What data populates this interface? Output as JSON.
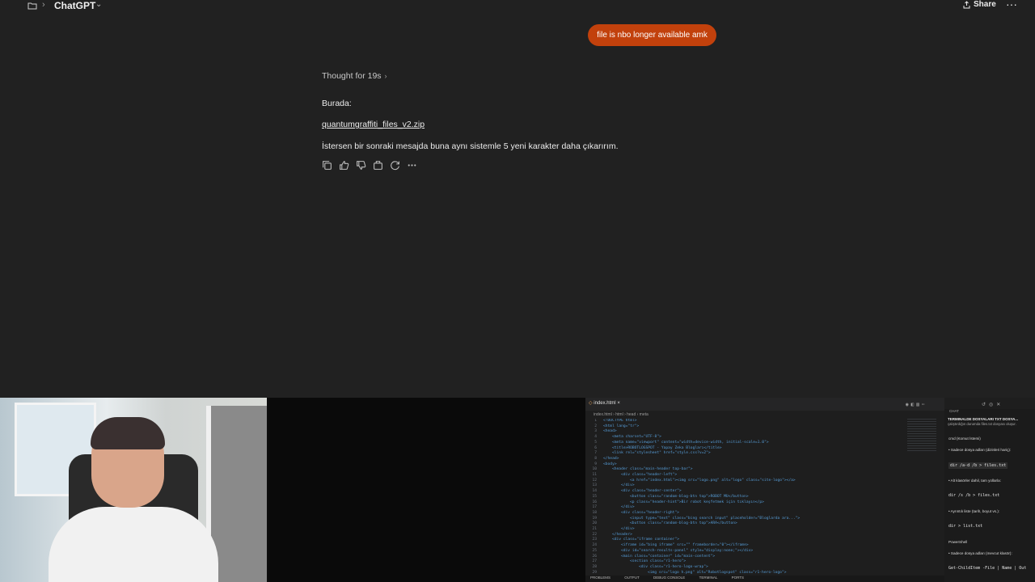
{
  "header": {
    "title": "ChatGPT",
    "breadcrumb_sep": "›",
    "title_chevron": "⌄",
    "share_label": "Share",
    "more_label": "···"
  },
  "conversation": {
    "user_message": "file is nbo longer available amk",
    "thought_label": "Thought for 19s",
    "thought_chevron": "›",
    "para1": "Burada:",
    "link": "quantumgraffiti_files_v2.zip",
    "para2": "İstersen bir sonraki mesajda buna aynı sistemle 5 yeni karakter daha çıkarırım.",
    "actions": [
      "copy-icon",
      "thumbs-up-icon",
      "thumbs-down-icon",
      "share-icon",
      "regenerate-icon",
      "more-icon"
    ]
  },
  "vscode": {
    "tab_label": "index.html",
    "tab_close": "×",
    "breadcrumb": "index.html › html › head › meta",
    "status_left": "PROBLEMS",
    "status_items": [
      "OUTPUT",
      "DEBUG CONSOLE",
      "TERMINAL",
      "PORTS"
    ],
    "code_lines": [
      {
        "n": "1",
        "indent": 0,
        "text": "<!DOCTYPE html>"
      },
      {
        "n": "2",
        "indent": 0,
        "text": "<html lang=\"tr\">"
      },
      {
        "n": "3",
        "indent": 0,
        "text": "<head>"
      },
      {
        "n": "4",
        "indent": 1,
        "text": "<meta charset=\"UTF-8\">"
      },
      {
        "n": "5",
        "indent": 1,
        "text": "<meta name=\"viewport\" content=\"width=device-width, initial-scale=1.0\">"
      },
      {
        "n": "6",
        "indent": 1,
        "text": "<title>ROBOTLOGSPOT - Yapay Zeka Blogları</title>"
      },
      {
        "n": "7",
        "indent": 1,
        "text": "<link rel=\"stylesheet\" href=\"style.css?v=2\">"
      },
      {
        "n": "8",
        "indent": 0,
        "text": "</head>"
      },
      {
        "n": "9",
        "indent": 0,
        "text": "<body>"
      },
      {
        "n": "10",
        "indent": 1,
        "text": "<header class=\"main-header top-bar\">"
      },
      {
        "n": "11",
        "indent": 2,
        "text": "<div class=\"header-left\">"
      },
      {
        "n": "12",
        "indent": 3,
        "text": "<a href=\"index.html\"><img src=\"logo.png\" alt=\"logo\" class=\"site-logo\"></a>"
      },
      {
        "n": "13",
        "indent": 2,
        "text": "</div>"
      },
      {
        "n": "14",
        "indent": 2,
        "text": "<div class=\"header-center\">"
      },
      {
        "n": "15",
        "indent": 3,
        "text": "<button class=\"random-blog-btn top\">ROBOT MU</button>"
      },
      {
        "n": "16",
        "indent": 3,
        "text": "<p class=\"header-hint\">Bir robot keşfetmek için tıklayın</p>"
      },
      {
        "n": "17",
        "indent": 2,
        "text": "</div>"
      },
      {
        "n": "18",
        "indent": 2,
        "text": "<div class=\"header-right\">"
      },
      {
        "n": "19",
        "indent": 3,
        "text": "<input type=\"text\" class=\"bing search input\" placeholder=\"Bloglarda ara...\">"
      },
      {
        "n": "20",
        "indent": 3,
        "text": "<button class=\"random-blog-btn top\">ARA</button>"
      },
      {
        "n": "21",
        "indent": 2,
        "text": "</div>"
      },
      {
        "n": "22",
        "indent": 1,
        "text": "</header>"
      },
      {
        "n": "23",
        "indent": 1,
        "text": "<div class=\"iframe container\">"
      },
      {
        "n": "24",
        "indent": 2,
        "text": "<iframe id=\"bing iframe\" src=\"\" frameborder=\"0\"></iframe>"
      },
      {
        "n": "25",
        "indent": 2,
        "text": "<div id=\"search-results-panel\" style=\"display:none;\"></div>"
      },
      {
        "n": "26",
        "indent": 2,
        "text": "<main class=\"container\" id=\"main-content\">"
      },
      {
        "n": "27",
        "indent": 3,
        "text": "<section class=\"r1-hero\">"
      },
      {
        "n": "28",
        "indent": 4,
        "text": "<div class=\"r1-hero-logo-wrap\">"
      },
      {
        "n": "29",
        "indent": 5,
        "text": "<img src=\"logo h.png\" alt=\"Robotlogspot\" class=\"r1-hero-logo\">"
      }
    ]
  },
  "chat_side": {
    "header": "CHAT",
    "title": "TERMINALDE DOSYALARI TXT DOSYA...",
    "subtitle": "çalıştırdığın durumda files.txt dosyası oluşur.",
    "items": [
      {
        "kind": "text",
        "text": "cmd (Komut İstemi)"
      },
      {
        "kind": "bullet",
        "text": "Sadece dosya adları (dizinleri hariç):"
      },
      {
        "kind": "code",
        "text": "dir /a-d /b > files.txt"
      },
      {
        "kind": "bullet",
        "text": "Alt klasörler dahil, tam yollarla:"
      },
      {
        "kind": "code",
        "text": "dir /s /b > files.txt"
      },
      {
        "kind": "bullet",
        "text": "Ayrıntılı liste (tarih, boyut vs.):"
      },
      {
        "kind": "code",
        "text": "dir > list.txt"
      },
      {
        "kind": "text",
        "text": "PowerShell"
      },
      {
        "kind": "bullet",
        "text": "Sadece dosya adları (mevcut klasör):"
      },
      {
        "kind": "code",
        "text": "Get-ChildItem -File | Name | Out"
      }
    ]
  },
  "colors": {
    "background": "#212121",
    "user_bubble": "#c2410c",
    "text": "#ececec"
  }
}
